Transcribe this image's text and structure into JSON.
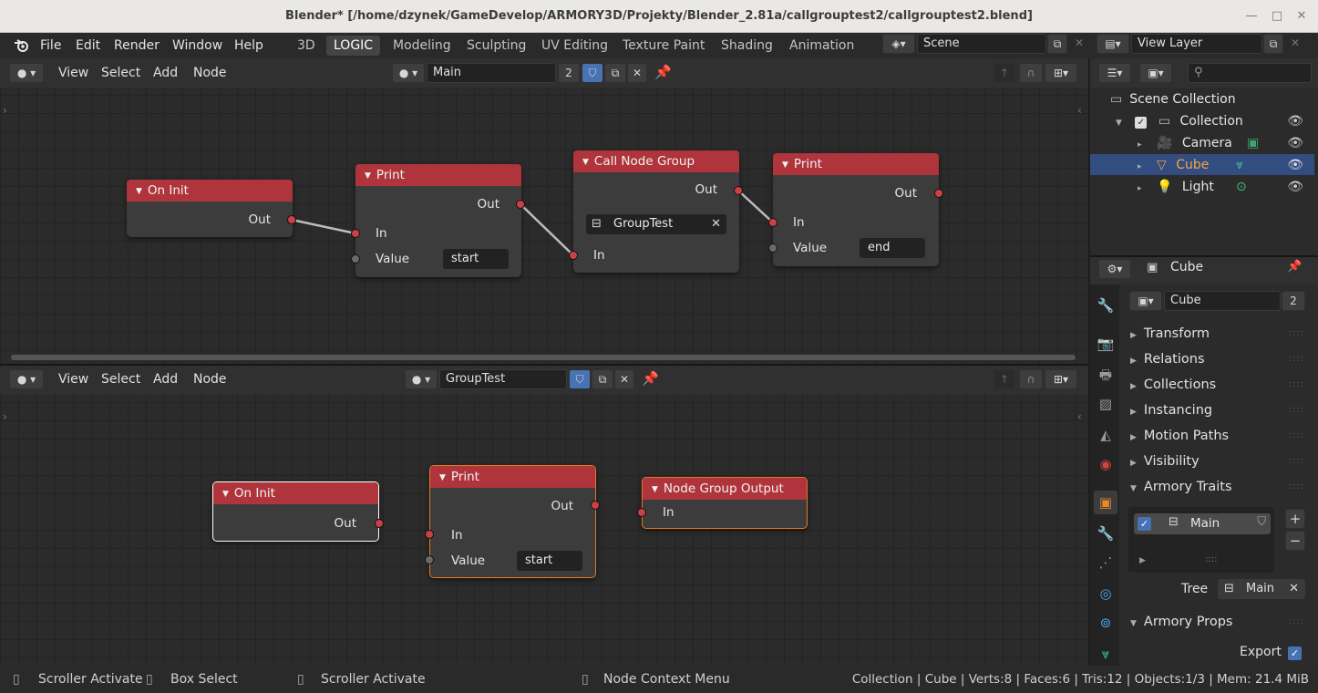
{
  "window": {
    "title": "Blender* [/home/dzynek/GameDevelop/ARMORY3D/Projekty/Blender_2.81a/callgrouptest2/callgrouptest2.blend]"
  },
  "menubar": {
    "items": [
      "File",
      "Edit",
      "Render",
      "Window",
      "Help"
    ]
  },
  "workspaces": {
    "tabs": [
      "3D",
      "LOGIC",
      "Modeling",
      "Sculpting",
      "UV Editing",
      "Texture Paint",
      "Shading",
      "Animation"
    ],
    "active": "LOGIC"
  },
  "scene": {
    "name": "Scene"
  },
  "view_layer": {
    "name": "View Layer"
  },
  "top_editor": {
    "menus": [
      "View",
      "Select",
      "Add",
      "Node"
    ],
    "tree_name": "Main",
    "users": "2",
    "nodes": {
      "on_init": {
        "title": "On Init",
        "out": "Out"
      },
      "print1": {
        "title": "Print",
        "out": "Out",
        "in": "In",
        "value_label": "Value",
        "value": "start"
      },
      "call_group": {
        "title": "Call Node Group",
        "out": "Out",
        "group": "GroupTest",
        "in": "In"
      },
      "print2": {
        "title": "Print",
        "out": "Out",
        "in": "In",
        "value_label": "Value",
        "value": "end"
      }
    }
  },
  "bottom_editor": {
    "menus": [
      "View",
      "Select",
      "Add",
      "Node"
    ],
    "tree_name": "GroupTest",
    "nodes": {
      "on_init": {
        "title": "On Init",
        "out": "Out"
      },
      "print": {
        "title": "Print",
        "out": "Out",
        "in": "In",
        "value_label": "Value",
        "value": "start"
      },
      "group_output": {
        "title": "Node Group Output",
        "in": "In"
      }
    }
  },
  "outliner": {
    "root": "Scene Collection",
    "collection": "Collection",
    "items": [
      "Camera",
      "Cube",
      "Light"
    ],
    "selected": "Cube"
  },
  "properties": {
    "object_name": "Cube",
    "data_name": "Cube",
    "data_users": "2",
    "panels": [
      "Transform",
      "Relations",
      "Collections",
      "Instancing",
      "Motion Paths",
      "Visibility"
    ],
    "armory_traits_label": "Armory Traits",
    "trait_name": "Main",
    "tree_label": "Tree",
    "tree_value": "Main",
    "armory_props_label": "Armory Props",
    "export_label": "Export"
  },
  "statusbar": {
    "left": [
      "Scroller Activate",
      "Box Select",
      "Scroller Activate",
      "Node Context Menu"
    ],
    "stats": "Collection | Cube | Verts:8 | Faces:6 | Tris:12 | Objects:1/3 | Mem: 21.4 MiB"
  },
  "colors": {
    "node_header": "#b0343c",
    "socket": "#c94045",
    "selected_row": "#334d80",
    "accent": "#4772b3"
  }
}
